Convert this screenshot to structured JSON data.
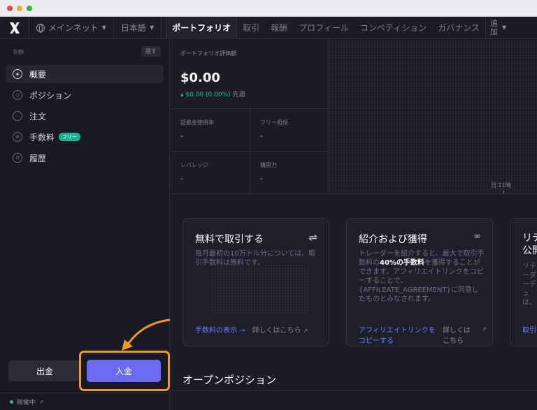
{
  "nav": {
    "network": "メインネット",
    "language": "日本語",
    "tabs": [
      {
        "label": "ポートフォリオ",
        "active": true
      },
      {
        "label": "取引"
      },
      {
        "label": "報酬"
      },
      {
        "label": "プロフィール"
      },
      {
        "label": "コンペティション"
      },
      {
        "label": "ガバナンス"
      }
    ],
    "more_line1": "追",
    "more_line2": "加"
  },
  "sidebar": {
    "heading": "皆観",
    "hide_label": "隠す",
    "items": [
      {
        "label": "概要",
        "icon": "overview-icon",
        "active": true
      },
      {
        "label": "ポジション",
        "icon": "positions-icon"
      },
      {
        "label": "注文",
        "icon": "orders-icon"
      },
      {
        "label": "手数料",
        "icon": "fees-icon",
        "badge": "フリー"
      },
      {
        "label": "履歴",
        "icon": "history-icon"
      }
    ],
    "withdraw_label": "出金",
    "deposit_label": "入金",
    "status_label": "稼働中",
    "highlight_color": "#f09a1a"
  },
  "portfolio": {
    "value_label": "ポートフォリオ評価額",
    "value": "$0.00",
    "change": "▴ $0.00 (0.00%)",
    "change_period": "先週",
    "stats": [
      {
        "label": "証拠金使用率",
        "value": "-"
      },
      {
        "label": "フリー担保",
        "value": "-"
      },
      {
        "label": "レバレッジ",
        "value": "-"
      },
      {
        "label": "購買力",
        "value": "-"
      }
    ],
    "chart_tick": "日 11時"
  },
  "cards": [
    {
      "title": "無料で取引する",
      "icon": "swap-icon",
      "desc": "毎月最初の10万ドル分については、取引手数料は無料です。",
      "link_primary": "手数料の表示 →",
      "link_secondary": "詳しくはこちら"
    },
    {
      "title": "紹介および獲得",
      "icon": "link-icon",
      "desc_prefix": "トレーダーを紹介すると、最大で取引手数料の",
      "desc_bold": "40%の手数料",
      "desc_suffix": "を獲得することができます。アフィリエイトリンクをコピーすることで、{AFFILEATE_AGREEMENT}に同意したものとみなされます。",
      "link_primary": "アフィリエイトリンクをコピーする",
      "link_secondary": "詳しくはこちら"
    },
    {
      "title": "リテ公開",
      "desc": "リテーダーデュは、があ",
      "link_primary": "取引"
    }
  ],
  "open_positions_title": "オープンポジション"
}
